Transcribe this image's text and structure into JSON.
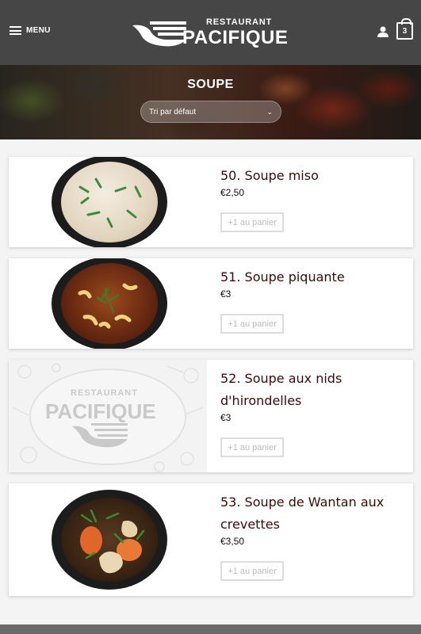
{
  "header": {
    "menu_label": "MENU",
    "logo_top": "RESTAURANT",
    "logo_main": "PACIFIQUE",
    "cart_count": "3",
    "icons": [
      "menu-icon",
      "user-icon",
      "cart-icon"
    ]
  },
  "banner": {
    "title": "SOUPE",
    "sort_value": "Tri par défaut"
  },
  "products": [
    {
      "name": "50. Soupe miso",
      "price": "€2,50",
      "button": "+1 au panier"
    },
    {
      "name": "51. Soupe piquante",
      "price": "€3",
      "button": "+1 au panier"
    },
    {
      "name": "52. Soupe aux nids d'hirondelles",
      "price": "€3",
      "button": "+1 au panier",
      "placeholder_top": "RESTAURANT",
      "placeholder_main": "PACIFIQUE"
    },
    {
      "name": "53. Soupe de Wantan aux crevettes",
      "price": "€3,50",
      "button": "+1 au panier"
    }
  ],
  "colors": {
    "header_bg": "#464646",
    "product_title": "#3a0a0a",
    "page_bg": "#f4f4f4"
  }
}
